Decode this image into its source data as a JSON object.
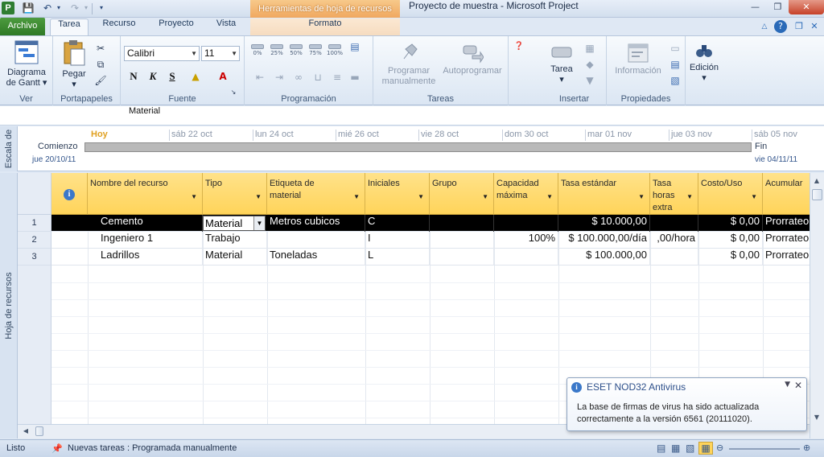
{
  "window": {
    "title": "Proyecto de muestra  -  Microsoft Project",
    "context_group": "Herramientas de hoja de recursos",
    "app_icon": "P"
  },
  "tabs": {
    "file": "Archivo",
    "items": [
      "Tarea",
      "Recurso",
      "Proyecto",
      "Vista"
    ],
    "context": "Formato"
  },
  "ribbon": {
    "ver": {
      "label": "Ver",
      "gantt": "Diagrama de Gantt"
    },
    "portapapeles": {
      "label": "Portapapeles",
      "pegar": "Pegar"
    },
    "fuente": {
      "label": "Fuente",
      "font": "Calibri",
      "size": "11",
      "bold": "N",
      "italic": "K",
      "underline": "S"
    },
    "programacion": {
      "label": "Programación",
      "pcts": [
        "0%",
        "25%",
        "50%",
        "75%",
        "100%"
      ]
    },
    "tareas": {
      "label": "Tareas",
      "manual": "Programar manualmente",
      "auto": "Autoprogramar"
    },
    "insertar": {
      "label": "Insertar",
      "tarea": "Tarea"
    },
    "propiedades": {
      "label": "Propiedades",
      "info": "Información"
    },
    "edicion": {
      "label": "Edición"
    }
  },
  "entry_bar": {
    "value": "Material"
  },
  "timeline": {
    "side_label": "Escala de",
    "today": "Hoy",
    "dates": [
      "sáb 22 oct",
      "lun 24 oct",
      "mié 26 oct",
      "vie 28 oct",
      "dom 30 oct",
      "mar 01 nov",
      "jue 03 nov",
      "sáb 05 nov"
    ],
    "start_label": "Comienzo",
    "start_date": "jue 20/10/11",
    "end_label": "Fin",
    "end_date": "vie 04/11/11"
  },
  "sheet": {
    "side_label": "Hoja de recursos",
    "columns": {
      "nombre": "Nombre del recurso",
      "tipo": "Tipo",
      "etiqueta": "Etiqueta de material",
      "iniciales": "Iniciales",
      "grupo": "Grupo",
      "capacidad": "Capacidad máxima",
      "tasa": "Tasa estándar",
      "tasa_extra": "Tasa horas extra",
      "costo": "Costo/Uso",
      "acumular": "Acumular"
    },
    "rows": [
      {
        "id": "1",
        "nombre": "Cemento",
        "tipo": "Material",
        "etiqueta": "Metros cubicos",
        "iniciales": "C",
        "grupo": "",
        "capacidad": "",
        "tasa": "$ 10.000,00",
        "tasa_extra": "",
        "costo": "$ 0,00",
        "acumular": "Prorrateo"
      },
      {
        "id": "2",
        "nombre": "Ingeniero 1",
        "tipo": "Trabajo",
        "etiqueta": "",
        "iniciales": "I",
        "grupo": "",
        "capacidad": "100%",
        "tasa": "$ 100.000,00/día",
        "tasa_extra": ",00/hora",
        "costo": "$ 0,00",
        "acumular": "Prorrateo"
      },
      {
        "id": "3",
        "nombre": "Ladrillos",
        "tipo": "Material",
        "etiqueta": "Toneladas",
        "iniciales": "L",
        "grupo": "",
        "capacidad": "",
        "tasa": "$ 100.000,00",
        "tasa_extra": "",
        "costo": "$ 0,00",
        "acumular": "Prorrateo"
      }
    ]
  },
  "notification": {
    "title": "ESET NOD32 Antivirus",
    "body": "La base de firmas de virus ha sido actualizada correctamente a la versión 6561 (20111020)."
  },
  "status": {
    "ready": "Listo",
    "new_tasks": "Nuevas tareas : Programada manualmente"
  },
  "colors": {
    "header": "#ffd45a",
    "file_tab": "#2f7a25",
    "selected_row": "#000000"
  }
}
